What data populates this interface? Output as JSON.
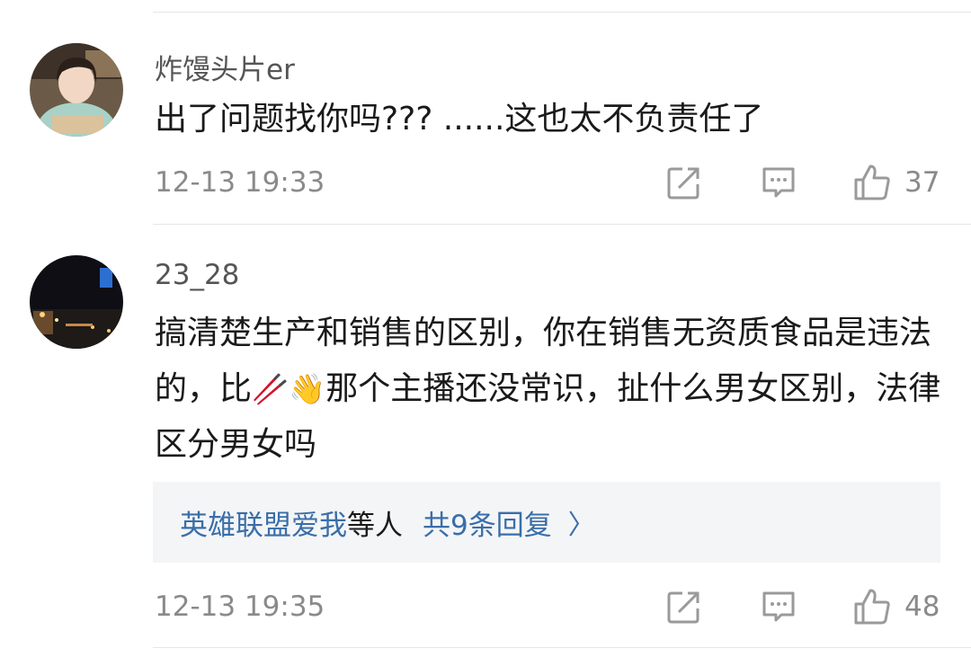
{
  "comments": [
    {
      "username": "炸馒头片er",
      "text": "出了问题找你吗??? ......这也太不负责任了",
      "time": "12-13 19:33",
      "likes": "37"
    },
    {
      "username": "23_28",
      "text_part1": "搞清楚生产和销售的区别，你在销售无资质食品是违法的，比",
      "emoji": "🥢👋",
      "text_part2": "那个主播还没常识，扯什么男女区别，法律区分男女吗",
      "replies": {
        "who": "英雄联盟爱我",
        "etc": "等人",
        "count": "共9条回复",
        "chevron": "〉"
      },
      "time": "12-13 19:35",
      "likes": "48"
    }
  ],
  "icons": {
    "share": "share-icon",
    "comment": "comment-icon",
    "like": "thumbs-up-icon"
  },
  "colors": {
    "link": "#3a6ea8",
    "meta": "#8a8a8a",
    "reply_bg": "#f4f5f7"
  }
}
